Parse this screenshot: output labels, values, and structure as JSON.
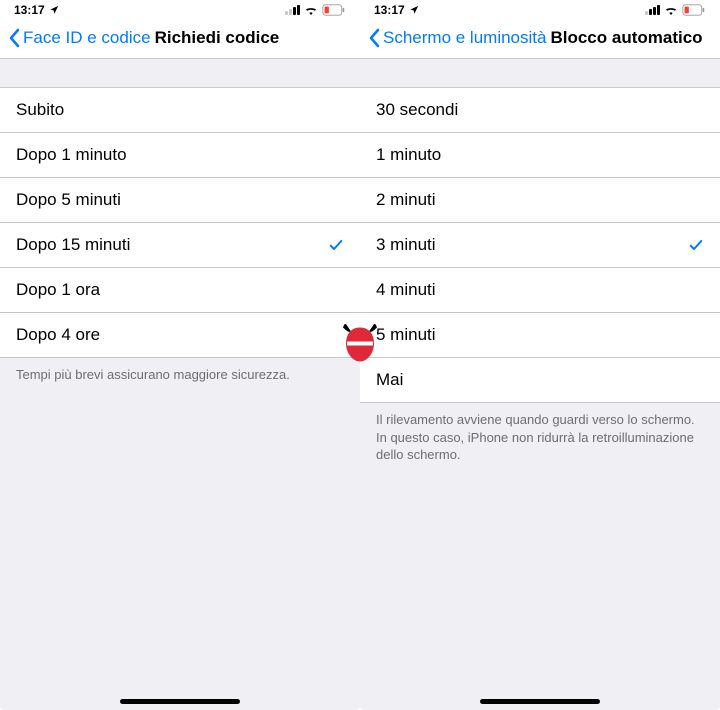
{
  "status": {
    "time": "13:17"
  },
  "left": {
    "back_label": "Face ID e codice",
    "title": "Richiedi codice",
    "options": [
      {
        "label": "Subito",
        "selected": false
      },
      {
        "label": "Dopo 1 minuto",
        "selected": false
      },
      {
        "label": "Dopo 5 minuti",
        "selected": false
      },
      {
        "label": "Dopo 15 minuti",
        "selected": true
      },
      {
        "label": "Dopo 1 ora",
        "selected": false
      },
      {
        "label": "Dopo 4 ore",
        "selected": false
      }
    ],
    "footer": "Tempi più brevi assicurano maggiore sicurezza."
  },
  "right": {
    "back_label": "Schermo e luminosità",
    "title": "Blocco automatico",
    "options": [
      {
        "label": "30 secondi",
        "selected": false
      },
      {
        "label": "1 minuto",
        "selected": false
      },
      {
        "label": "2 minuti",
        "selected": false
      },
      {
        "label": "3 minuti",
        "selected": true
      },
      {
        "label": "4 minuti",
        "selected": false
      },
      {
        "label": "5 minuti",
        "selected": false
      },
      {
        "label": "Mai",
        "selected": false
      }
    ],
    "footer": "Il rilevamento avviene quando guardi verso lo schermo. In questo caso, iPhone non ridurrà la retroilluminazione dello schermo."
  }
}
